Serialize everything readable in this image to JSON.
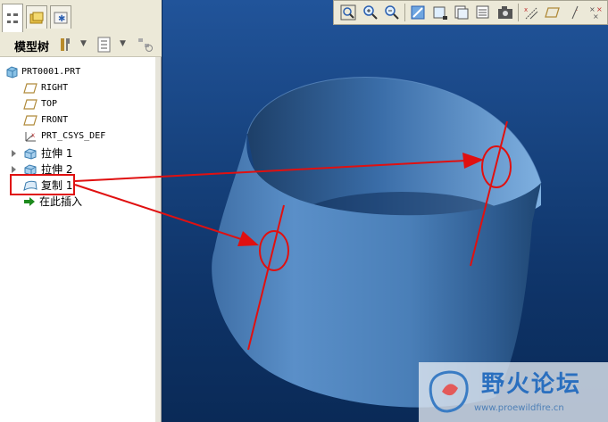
{
  "model_tree": {
    "title": "模型树",
    "items": [
      {
        "label": "PRT0001.PRT",
        "icon": "part-icon"
      },
      {
        "label": "RIGHT",
        "icon": "datum-plane-icon"
      },
      {
        "label": "TOP",
        "icon": "datum-plane-icon"
      },
      {
        "label": "FRONT",
        "icon": "datum-plane-icon"
      },
      {
        "label": "PRT_CSYS_DEF",
        "icon": "coordinate-system-icon"
      },
      {
        "label": "拉伸 1",
        "icon": "extrude-icon"
      },
      {
        "label": "拉伸 2",
        "icon": "extrude-icon"
      },
      {
        "label": "复制 1",
        "icon": "copy-surface-icon"
      },
      {
        "label": "在此插入",
        "icon": "insert-here-arrow-icon"
      }
    ]
  },
  "view_toolbar": {
    "buttons": [
      "zoom-fit-icon",
      "zoom-in-icon",
      "zoom-out-icon",
      "repaint-icon",
      "spin-center-icon",
      "saved-views-icon",
      "layers-icon",
      "datum-planes-icon",
      "datum-axes-icon",
      "datum-points-icon",
      "csys-icon"
    ]
  },
  "annotation": {
    "highlight_color": "#e01010",
    "arrow_color": "#e01010"
  },
  "colors": {
    "surface": "#4a7fb8",
    "viewport_bg": "#17437f"
  },
  "watermark": {
    "title": "野火论坛",
    "url": "www.proewildfire.cn"
  }
}
